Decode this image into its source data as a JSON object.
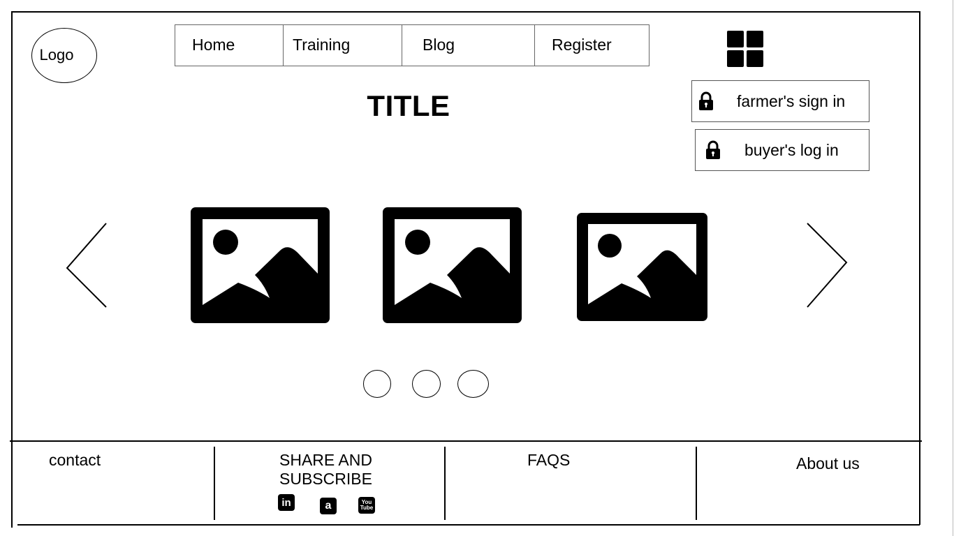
{
  "header": {
    "logo_label": "Logo",
    "nav": [
      {
        "label": "Home"
      },
      {
        "label": "Training"
      },
      {
        "label": "Blog"
      },
      {
        "label": "Register"
      }
    ],
    "menu_icon": "grid-icon"
  },
  "title": "TITLE",
  "auth": {
    "farmer_label": "farmer's sign in",
    "buyer_label": "buyer's log in",
    "icon": "lock-icon"
  },
  "carousel": {
    "prev_icon": "chevron-left-icon",
    "next_icon": "chevron-right-icon",
    "images": [
      "image-placeholder-icon",
      "image-placeholder-icon",
      "image-placeholder-icon"
    ],
    "dot_count": 3
  },
  "footer": {
    "contact": "contact",
    "share_line1": "SHARE AND",
    "share_line2": "SUBSCRIBE",
    "faqs": "FAQS",
    "about": "About us",
    "social": [
      {
        "icon": "linkedin-icon",
        "glyph": "in"
      },
      {
        "icon": "amazon-icon",
        "glyph": "a"
      },
      {
        "icon": "youtube-icon",
        "glyph": "You\nTube"
      }
    ]
  }
}
